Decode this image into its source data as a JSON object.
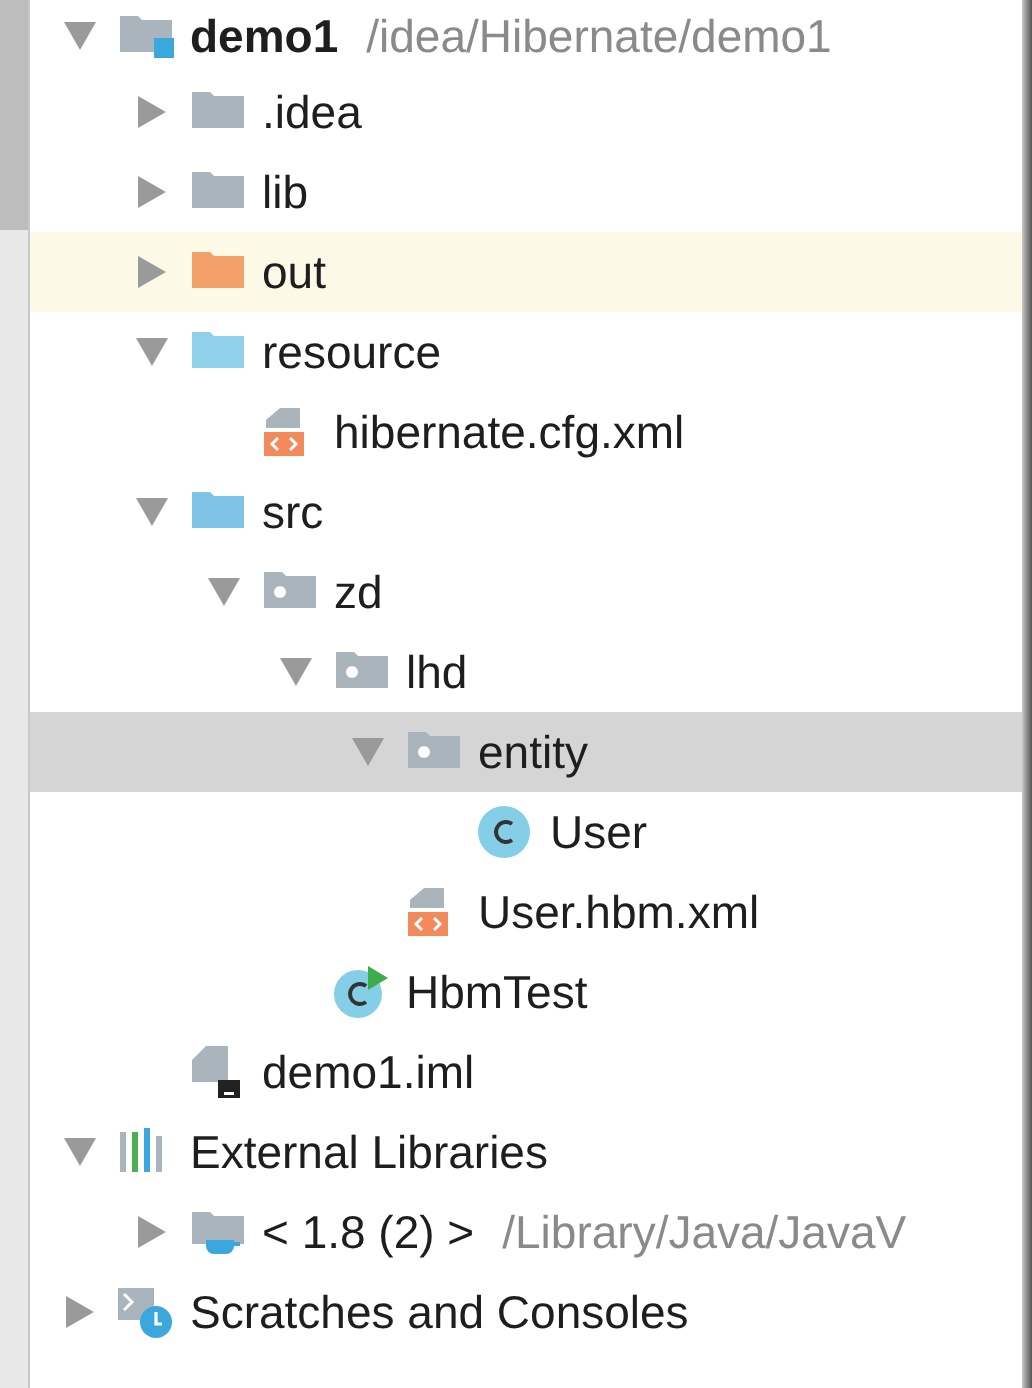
{
  "project_tree": [
    {
      "label": "demo1",
      "description": "/idea/Hibernate/demo1",
      "kind": "project",
      "expanded": true,
      "selected": false,
      "highlighted": false,
      "children": [
        {
          "label": ".idea",
          "kind": "folder",
          "expanded": false,
          "selected": false,
          "highlighted": false
        },
        {
          "label": "lib",
          "kind": "folder",
          "expanded": false,
          "selected": false,
          "highlighted": false
        },
        {
          "label": "out",
          "kind": "excluded-folder",
          "expanded": false,
          "selected": false,
          "highlighted": true
        },
        {
          "label": "resource",
          "kind": "resource-folder",
          "expanded": true,
          "selected": false,
          "highlighted": false,
          "children": [
            {
              "label": "hibernate.cfg.xml",
              "kind": "xml",
              "selected": false,
              "highlighted": false
            }
          ]
        },
        {
          "label": "src",
          "kind": "source-folder",
          "expanded": true,
          "selected": false,
          "highlighted": false,
          "children": [
            {
              "label": "zd",
              "kind": "package",
              "expanded": true,
              "selected": false,
              "highlighted": false,
              "children": [
                {
                  "label": "lhd",
                  "kind": "package",
                  "expanded": true,
                  "selected": false,
                  "highlighted": false,
                  "children": [
                    {
                      "label": "entity",
                      "kind": "package",
                      "expanded": true,
                      "selected": true,
                      "highlighted": false,
                      "children": [
                        {
                          "label": "User",
                          "kind": "class",
                          "selected": false,
                          "highlighted": false
                        }
                      ]
                    },
                    {
                      "label": "User.hbm.xml",
                      "kind": "xml",
                      "selected": false,
                      "highlighted": false
                    }
                  ]
                },
                {
                  "label": "HbmTest",
                  "kind": "runnable-class",
                  "selected": false,
                  "highlighted": false
                }
              ]
            }
          ]
        },
        {
          "label": "demo1.iml",
          "kind": "module-file",
          "selected": false,
          "highlighted": false
        }
      ]
    },
    {
      "label": "External Libraries",
      "kind": "libraries",
      "expanded": true,
      "selected": false,
      "highlighted": false,
      "children": [
        {
          "label": "< 1.8 (2) >",
          "description": "/Library/Java/JavaV",
          "kind": "jdk",
          "expanded": false,
          "selected": false,
          "highlighted": false
        }
      ]
    },
    {
      "label": "Scratches and Consoles",
      "kind": "scratches",
      "expanded": false,
      "selected": false,
      "highlighted": false
    }
  ]
}
